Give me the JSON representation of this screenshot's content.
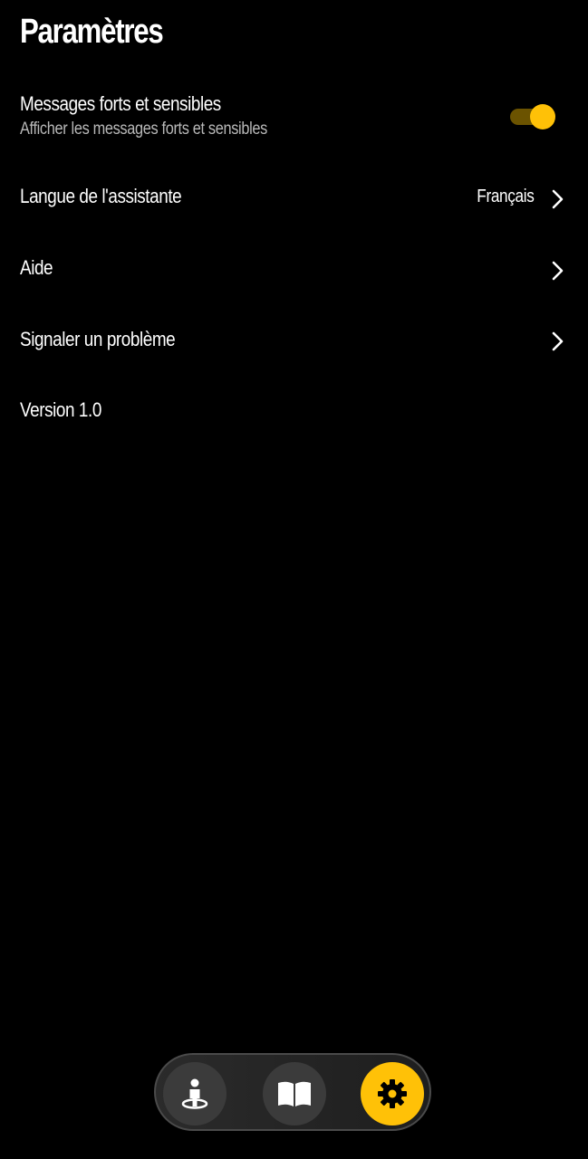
{
  "header": {
    "title": "Paramètres"
  },
  "settings": {
    "sensitive": {
      "label": "Messages forts et sensibles",
      "description": "Afficher les messages forts et sensibles",
      "enabled": true
    },
    "language": {
      "label": "Langue de l'assistante",
      "value": "Français"
    },
    "help": {
      "label": "Aide"
    },
    "report": {
      "label": "Signaler un problème"
    },
    "version": {
      "label": "Version 1.0"
    }
  },
  "bottom_nav": {
    "items": [
      {
        "icon": "person-location-icon",
        "active": false
      },
      {
        "icon": "book-icon",
        "active": false
      },
      {
        "icon": "gear-icon",
        "active": true
      }
    ]
  },
  "colors": {
    "accent": "#ffc107",
    "background": "#000000",
    "toggle_track": "#6b5300",
    "nav_button": "#3b3b3b"
  }
}
